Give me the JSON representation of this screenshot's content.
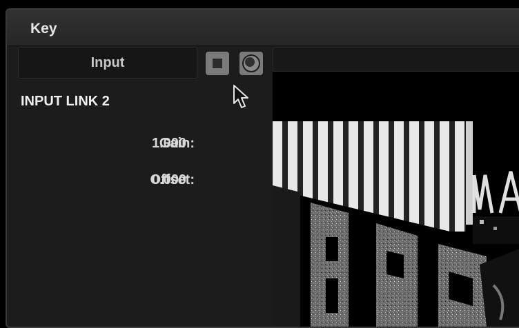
{
  "window": {
    "title": "Key"
  },
  "input_selector": {
    "label": "Input"
  },
  "buttons": {
    "key_mask_icon": "square-stop-icon",
    "key_output_icon": "circle-record-icon"
  },
  "section": {
    "heading": "INPUT LINK 2"
  },
  "params": [
    {
      "label": "Gain:",
      "value": "1.000"
    },
    {
      "label": "Offset:",
      "value": "0.000"
    }
  ],
  "viewer": {
    "content": "high-contrast key matte preview"
  },
  "colors": {
    "panel": "#1c1c1c",
    "titlebar": "#2c2c2c",
    "button_gray": "#7b7b7b",
    "text": "#d8d8d8"
  }
}
